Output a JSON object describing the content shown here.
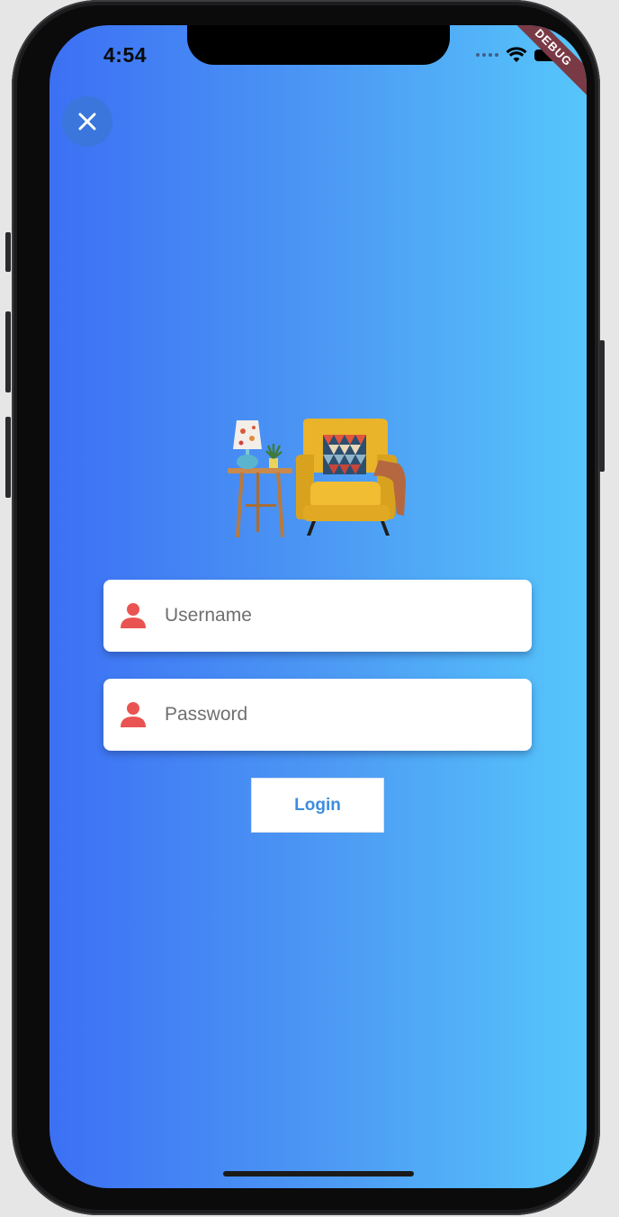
{
  "status_bar": {
    "time": "4:54",
    "icons": [
      "cellular-dots-icon",
      "wifi-icon",
      "battery-icon"
    ]
  },
  "debug_banner": "DEBUG",
  "close_button": {
    "icon": "close-icon"
  },
  "illustration": {
    "icon": "armchair-lamp-illustration"
  },
  "form": {
    "username_placeholder": "Username",
    "password_placeholder": "Password",
    "field_icon": "user-icon",
    "login_label": "Login"
  },
  "colors": {
    "gradient_start": "#3c70f4",
    "gradient_end": "#56c6fb",
    "icon_accent": "#e95452",
    "button_text": "#3c8ddf"
  }
}
